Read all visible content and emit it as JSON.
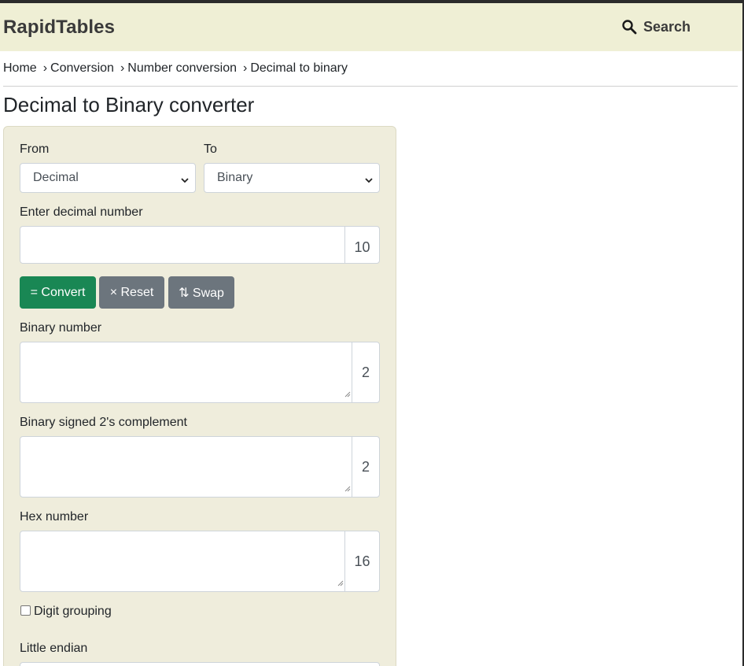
{
  "header": {
    "logo": "RapidTables",
    "search_label": "Search"
  },
  "breadcrumb": [
    {
      "label": "Home"
    },
    {
      "label": "Conversion"
    },
    {
      "label": "Number conversion"
    },
    {
      "label": "Decimal to binary"
    }
  ],
  "breadcrumb_separator": "›",
  "page_title": "Decimal to Binary converter",
  "converter": {
    "from_label": "From",
    "from_value": "Decimal",
    "to_label": "To",
    "to_value": "Binary",
    "input_label": "Enter decimal number",
    "input_value": "",
    "input_base": "10",
    "buttons": {
      "convert": "= Convert",
      "reset": "× Reset",
      "swap": "⇅ Swap"
    },
    "binary_label": "Binary number",
    "binary_value": "",
    "binary_base": "2",
    "twos_label": "Binary signed 2's complement",
    "twos_value": "",
    "twos_base": "2",
    "hex_label": "Hex number",
    "hex_value": "",
    "hex_base": "16",
    "digit_grouping_label": "Digit grouping",
    "digit_grouping_checked": false,
    "little_endian_label": "Little endian"
  },
  "colors": {
    "header_bg": "#efefd5",
    "panel_bg": "#efeddc",
    "convert_button": "#198754",
    "secondary_button": "#6c757d"
  }
}
